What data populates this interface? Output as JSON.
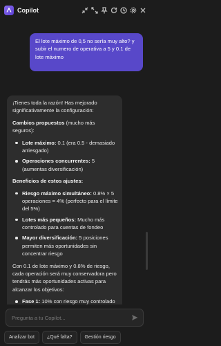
{
  "header": {
    "title": "Copilot",
    "icons": [
      "collapse-icon",
      "expand-icon",
      "pin-icon",
      "refresh-icon",
      "history-icon",
      "settings-icon",
      "close-icon"
    ]
  },
  "user_message": "El lote máximo de 0,5 no sería muy alto? y subir el numero de operativa a 5 y 0.1 de lote máximo",
  "assistant": {
    "intro": "¡Tienes toda la razón! Has mejorado significativamente la configuración:",
    "section1_title": "Cambios propuestos",
    "section1_suffix": " (mucho más seguros):",
    "changes": [
      {
        "bold": "Lote máximo:",
        "text": " 0.1 (era 0.5 - demasiado arriesgado)"
      },
      {
        "bold": "Operaciones concurrentes:",
        "text": " 5 (aumentas diversificación)"
      }
    ],
    "section2_title": "Beneficios de estos ajustes:",
    "benefits": [
      {
        "bold": "Riesgo máximo simultáneo:",
        "text": " 0.8% × 5 operaciones = 4% (perfecto para el límite del 5%)"
      },
      {
        "bold": "Lotes más pequeños:",
        "text": " Mucho más controlado para cuentas de fondeo"
      },
      {
        "bold": "Mayor diversificación:",
        "text": " 5 posiciones permiten más oportunidades sin concentrar riesgo"
      }
    ],
    "summary": "Con 0.1 de lote máximo y 0.8% de riesgo, cada operación será muy conservadora pero tendrás más oportunidades activas para alcanzar los objetivos:",
    "phases": [
      {
        "bold": "Fase 1:",
        "text": " 10% con riesgo muy controlado"
      }
    ]
  },
  "input": {
    "placeholder": "Pregunta a tu Copilot..."
  },
  "chips": [
    "Analizar bot",
    "¿Qué falta?",
    "Gestión riesgo"
  ],
  "colors": {
    "background": "#1c1c1c",
    "user_bubble": "#5848c9",
    "bot_bubble": "#2d2d2d"
  }
}
